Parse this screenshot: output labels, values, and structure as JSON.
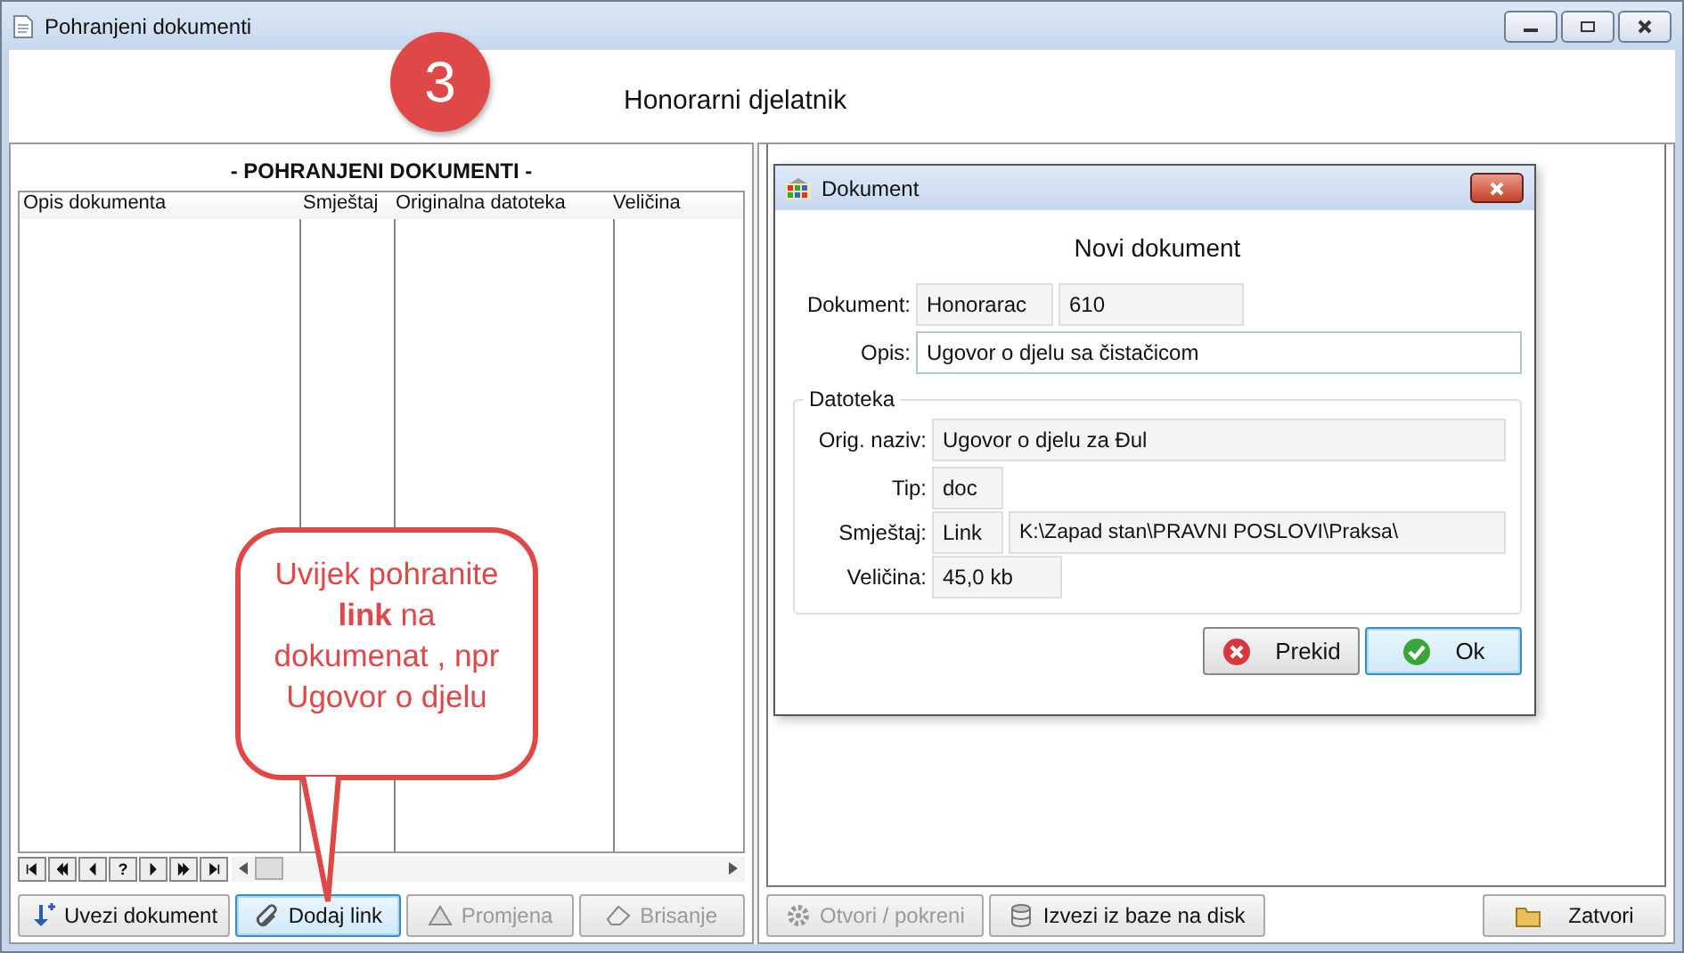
{
  "window": {
    "title": "Pohranjeni dokumenti"
  },
  "header": {
    "step_badge": "3",
    "title": "Honorarni djelatnik"
  },
  "documents_panel": {
    "title": "- POHRANJENI DOKUMENTI -",
    "table": {
      "columns": [
        "Opis dokumenta",
        "Smještaj",
        "Originalna datoteka",
        "Veličina"
      ]
    },
    "navigator": [
      {
        "kind": "first"
      },
      {
        "kind": "prev-page"
      },
      {
        "kind": "prev"
      },
      {
        "kind": "help",
        "label": "?"
      },
      {
        "kind": "next"
      },
      {
        "kind": "next-page"
      },
      {
        "kind": "last"
      }
    ],
    "buttons": [
      {
        "label": "Uvezi dokument",
        "kind": "import",
        "disabled": false,
        "selected": false
      },
      {
        "label": "Dodaj link",
        "kind": "link",
        "disabled": false,
        "selected": true
      },
      {
        "label": "Promjena",
        "kind": "edit",
        "disabled": true,
        "selected": false
      },
      {
        "label": "Brisanje",
        "kind": "delete",
        "disabled": true,
        "selected": false
      }
    ]
  },
  "right_panel": {
    "buttons": [
      {
        "label": "Otvori / pokreni",
        "kind": "open",
        "disabled": true
      },
      {
        "label": "Izvezi iz baze na disk",
        "kind": "export",
        "disabled": false
      }
    ],
    "close_button": {
      "label": "Zatvori"
    }
  },
  "dialog": {
    "title": "Dokument",
    "heading": "Novi dokument",
    "dokument": {
      "label": "Dokument:",
      "type": "Honorarac",
      "number": "610"
    },
    "opis": {
      "label": "Opis:",
      "value": "Ugovor o djelu sa čistačicom"
    },
    "group": {
      "title": "Datoteka",
      "orig_naziv": {
        "label": "Orig. naziv:",
        "value": "Ugovor o djelu za Đul"
      },
      "tip": {
        "label": "Tip:",
        "value": "doc"
      },
      "smjestaj": {
        "label": "Smještaj:",
        "kind": "Link",
        "path": "K:\\Zapad stan\\PRAVNI POSLOVI\\Praksa\\"
      },
      "velicina": {
        "label": "Veličina:",
        "value": "45,0 kb"
      }
    },
    "buttons": [
      {
        "label": "Prekid",
        "kind": "cancel",
        "selected": false
      },
      {
        "label": "Ok",
        "kind": "ok",
        "selected": true
      }
    ]
  },
  "callout": {
    "text": "Uvijek pohranite **link** na dokumenat , npr Ugovor o djelu"
  }
}
